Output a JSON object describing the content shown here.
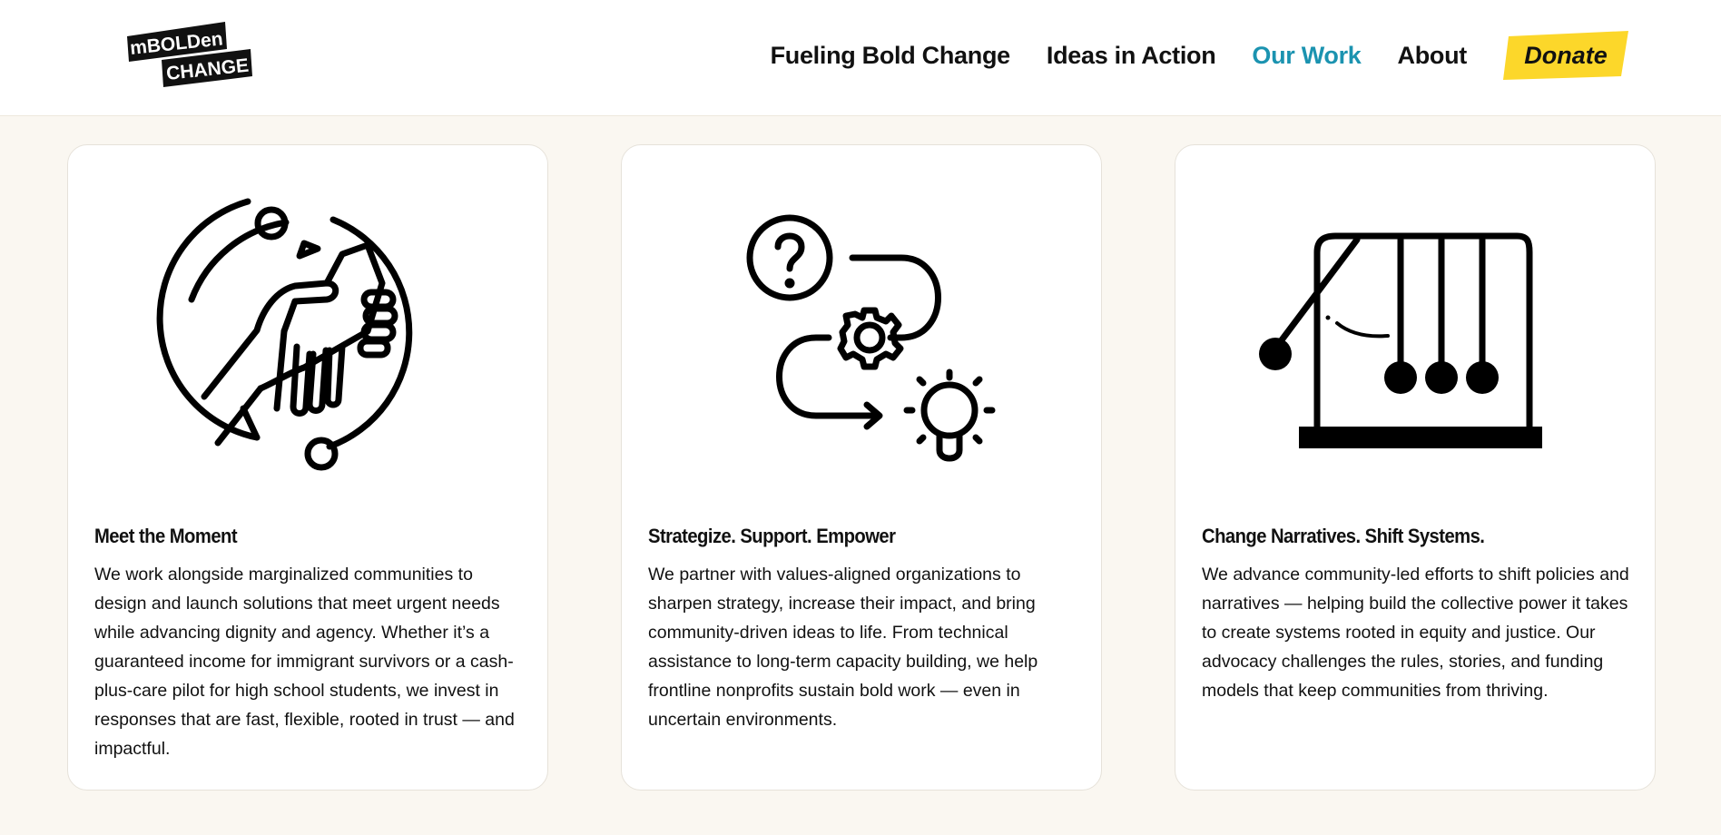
{
  "brand": {
    "logo_line1": "mBOLDen",
    "logo_line2": "CHANGE"
  },
  "nav": {
    "items": [
      {
        "label": "Fueling Bold Change",
        "active": false
      },
      {
        "label": "Ideas in Action",
        "active": false
      },
      {
        "label": "Our Work",
        "active": true
      },
      {
        "label": "About",
        "active": false
      }
    ],
    "donate_label": "Donate"
  },
  "colors": {
    "page_background": "#faf7f1",
    "header_background": "#ffffff",
    "active_nav": "#1b93b0",
    "donate_yellow": "#fcd72a",
    "card_background": "#ffffff"
  },
  "cards": [
    {
      "icon": "handshake-icon",
      "title": "Meet the Moment",
      "body": "We work alongside marginalized communities to design and launch solutions that meet urgent needs while advancing dignity and agency. Whether it’s a guaranteed income for immigrant survivors or a cash-plus-care pilot for high school students, we invest in responses that are fast, flexible, rooted in trust — and impactful."
    },
    {
      "icon": "strategy-process-icon",
      "title": "Strategize. Support. Empower",
      "body": "We partner with values-aligned organizations to sharpen strategy, increase their impact, and bring community-driven ideas to life. From technical assistance to long-term capacity building, we help frontline nonprofits sustain bold work — even in uncertain environments."
    },
    {
      "icon": "newtons-cradle-icon",
      "title": "Change Narratives. Shift Systems.",
      "body": "We advance community-led efforts to shift policies and narratives — helping build the collective power it takes to create systems rooted in equity and justice. Our advocacy challenges the rules, stories, and funding models that keep communities from thriving."
    }
  ]
}
